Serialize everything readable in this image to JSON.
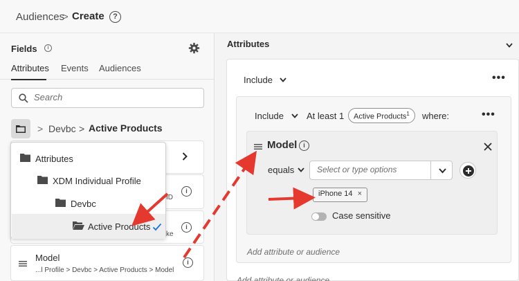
{
  "header": {
    "breadcrumb_parent": "Audiences",
    "breadcrumb_separator": ">",
    "breadcrumb_current": "Create",
    "help_glyph": "?"
  },
  "fields_panel": {
    "title": "Fields",
    "info_glyph": "i",
    "tabs": [
      {
        "label": "Attributes",
        "active": true
      },
      {
        "label": "Events",
        "active": false
      },
      {
        "label": "Audiences",
        "active": false
      }
    ],
    "search_placeholder": "Search",
    "path": [
      "Devbc",
      "Active Products"
    ],
    "path_separator": ">",
    "row_tails": [
      "ID",
      "ke"
    ],
    "model_row": {
      "name": "Model",
      "path": "...l Profile > Devbc > Active Products > Model"
    }
  },
  "folder_popover": {
    "items": [
      "Attributes",
      "XDM Individual Profile",
      "Devbc",
      "Active Products"
    ],
    "selected": "Active Products"
  },
  "attributes_panel": {
    "title": "Attributes",
    "include_label": "Include",
    "rule": {
      "include_label": "Include",
      "quantifier": "At least 1",
      "object_tag": "Active Products",
      "object_tag_sup": "1",
      "where_label": "where:"
    },
    "condition": {
      "attribute": "Model",
      "operator": "equals",
      "value_placeholder": "Select or type options",
      "values": [
        "iPhone 14"
      ],
      "chip_remove_glyph": "×",
      "case_sensitive_label": "Case sensitive",
      "case_sensitive": false
    },
    "add_attribute_label": "Add attribute or audience",
    "add_attribute_label_outer": "Add attribute or audience"
  },
  "colors": {
    "annotation_arrow": "#e5392f",
    "panel_bg": "#f8f8f8",
    "card_bg": "#ffffff"
  },
  "icons": [
    "help-icon",
    "info-icon",
    "gear-icon",
    "search-icon",
    "folder-icon",
    "chevron-right-icon",
    "chevron-down-icon",
    "drag-handle-icon",
    "more-icon",
    "close-icon",
    "plus-icon",
    "check-icon"
  ]
}
